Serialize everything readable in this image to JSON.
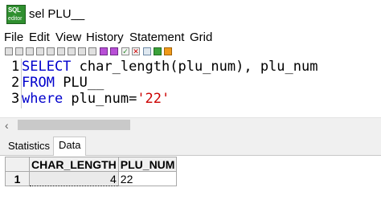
{
  "window": {
    "icon_line1": "SQL",
    "icon_line2": "editor",
    "title": "sel PLU__"
  },
  "menu": [
    "File",
    "Edit",
    "View",
    "History",
    "Statement",
    "Grid"
  ],
  "editor": {
    "line_numbers": [
      "1",
      "2",
      "3"
    ],
    "lines": [
      {
        "kw1": "SELECT",
        "rest": " char_length(plu_num), plu_num"
      },
      {
        "kw1": "FROM",
        "rest": " PLU__"
      },
      {
        "kw1": "where",
        "rest": " plu_num=",
        "str": "'22'"
      }
    ]
  },
  "scroll": {
    "left_arrow": "‹"
  },
  "tabs": {
    "statistics": "Statistics",
    "data": "Data"
  },
  "results": {
    "columns": [
      "CHAR_LENGTH",
      "PLU_NUM"
    ],
    "rows": [
      {
        "row_num": "1",
        "char_length": "4",
        "plu_num": "22"
      }
    ]
  }
}
